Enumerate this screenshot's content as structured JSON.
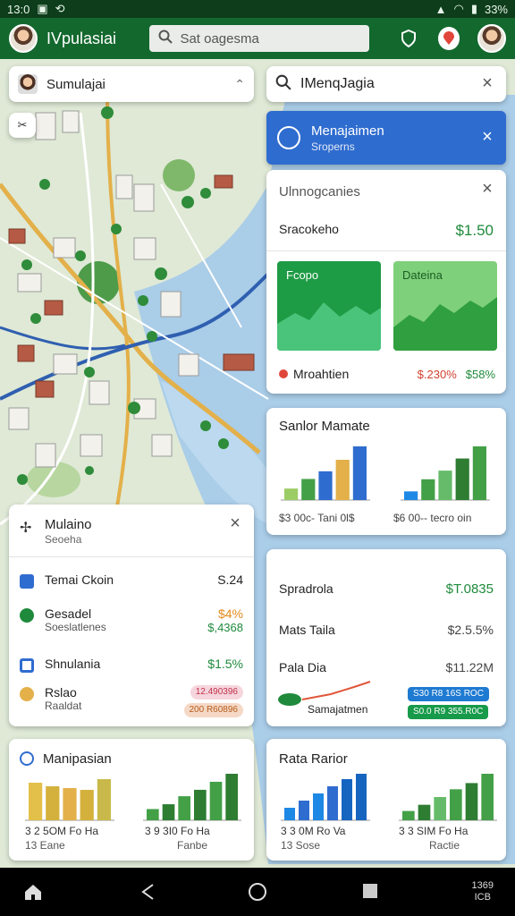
{
  "status": {
    "time": "13:0",
    "battery": "33%"
  },
  "appbar": {
    "title": "IVpulasiai",
    "search_placeholder": "Sat oagesma"
  },
  "sim_card": {
    "label": "Sumulajai"
  },
  "search_panel": {
    "label": "IMenqJagia"
  },
  "mgmt_banner": {
    "title": "Menajaimen",
    "subtitle": "Sroperns"
  },
  "info_card": {
    "title": "Ulnnogcanies",
    "row_label": "Sracokeho",
    "row_value": "$1.50",
    "tile_a": "Fcopo",
    "tile_b": "Dateina",
    "footer_label": "Mroahtien",
    "footer_value_red": "$.230%",
    "footer_value_green": "$58%"
  },
  "sales_card": {
    "title": "Sanlor Mamate",
    "caption_left": "$3  00c- Tani 0l$",
    "caption_right": "$6  00-- tecro oin",
    "chart_left": [
      12,
      22,
      30,
      42,
      56
    ],
    "chart_right": [
      10,
      24,
      34,
      48,
      62
    ]
  },
  "market_card": {
    "title": "Mulaino",
    "subtitle": "Seoeha",
    "rows": [
      {
        "label": "Temai Ckoin",
        "sub": "",
        "value": "S.24",
        "value2": ""
      },
      {
        "label": "Gesadel",
        "sub": "Soeslatlenes",
        "value": "$4%",
        "value2": "$,4368"
      },
      {
        "label": "Shnulania",
        "sub": "",
        "value": "$1.5%",
        "value2": ""
      },
      {
        "label": "Rslao",
        "sub": "Raaldat",
        "pill1": "12.490396",
        "pill2": "200 R60896"
      }
    ]
  },
  "spread_card": {
    "rows": [
      {
        "label": "Spradrola",
        "value": "$T.0835"
      },
      {
        "label": "Mats Taila",
        "value": "$2.5.5%"
      },
      {
        "label": "Pala Dia",
        "value": "$11.22M"
      }
    ],
    "footer_label": "Samajatmen",
    "badge1": "S30 R8 16S ROC",
    "badge2": "S0.0 R9 355.R0C"
  },
  "bottom_left": {
    "title": "Manipasian",
    "caption_left": "3  2  5OM Fo Ha",
    "caption_left2": "13      Eane",
    "caption_right": "3  9  3I0 Fo Ha",
    "caption_right2": "Fanbe",
    "chart_left": [
      42,
      38,
      36,
      34,
      46
    ],
    "chart_right": [
      14,
      20,
      30,
      38,
      48,
      58
    ]
  },
  "bottom_right": {
    "title": "Rata Rarior",
    "caption_left": "3  3  0M  Ro Va",
    "caption_left2": "13      Sose",
    "caption_right": "3  3  SIM Fo Ha",
    "caption_right2": "Ractie",
    "chart_left": [
      14,
      22,
      30,
      38,
      46,
      52
    ],
    "chart_right": [
      12,
      20,
      30,
      40,
      48,
      60
    ]
  },
  "navbar": {
    "time": "1369",
    "date": "ICB"
  },
  "colors": {
    "brand_green": "#13682e",
    "accent_blue": "#2f6ccf",
    "positive": "#1f8a3c",
    "negative": "#d2412f"
  }
}
